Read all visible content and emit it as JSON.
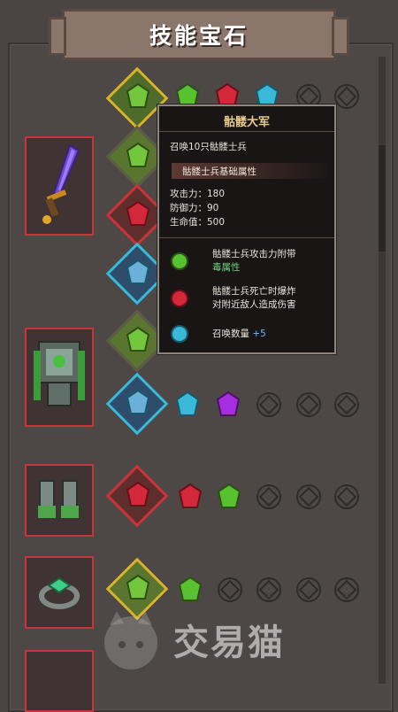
{
  "title": "技能宝石",
  "tooltip": {
    "name": "骷髅大军",
    "summary": "召唤10只骷髅士兵",
    "base_header": "骷髅士兵基础属性",
    "stats": [
      "攻击力：180",
      "防御力：90",
      "生命值：500"
    ],
    "effects": [
      {
        "color": "green",
        "line1": "骷髅士兵攻击力附带",
        "line2": "毒属性"
      },
      {
        "color": "red",
        "line1": "骷髅士兵死亡时爆炸",
        "line2": "对附近敌人造成伤害"
      },
      {
        "color": "blue",
        "line1": "召唤数量",
        "suffix": "+5"
      }
    ]
  },
  "items": [
    {
      "name": "sword",
      "slots": [
        "green",
        "green",
        "red",
        "blue"
      ]
    },
    {
      "name": "armor",
      "slots": [
        "green",
        "blue"
      ]
    },
    {
      "name": "gloves",
      "slots": [
        "red"
      ]
    },
    {
      "name": "ring",
      "slots": [
        "green"
      ]
    }
  ],
  "colors": {
    "green": "#57c12f",
    "red": "#d3283a",
    "blue": "#39b8d8",
    "purple": "#a62ee0",
    "frame_red": "#c9343a",
    "frame_gold": "#d8b12b"
  },
  "watermark": "交易猫"
}
